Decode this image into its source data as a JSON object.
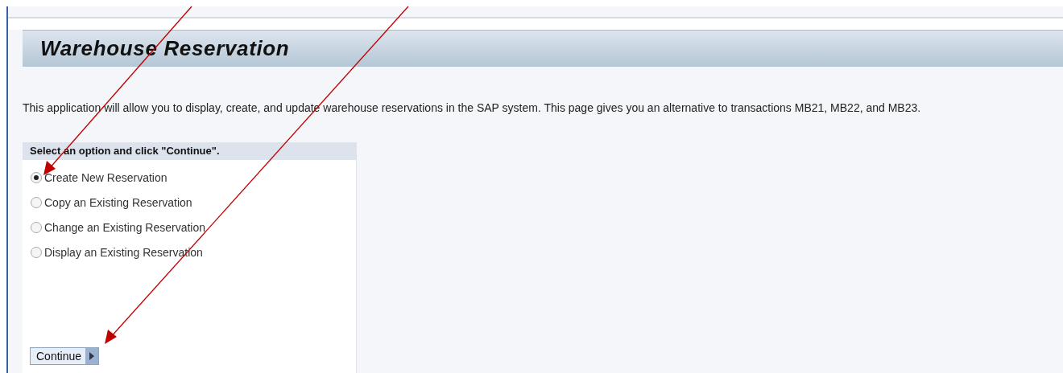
{
  "page": {
    "title": "Warehouse Reservation",
    "intro": "This application will allow you to display, create, and update warehouse reservations in the SAP system.  This page gives you an alternative to transactions MB21, MB22, and MB23."
  },
  "options_panel": {
    "heading": "Select an option and click \"Continue\".",
    "options": [
      {
        "label": "Create New Reservation",
        "selected": true
      },
      {
        "label": "Copy an Existing Reservation",
        "selected": false
      },
      {
        "label": "Change an Existing Reservation",
        "selected": false
      },
      {
        "label": "Display an Existing Reservation",
        "selected": false
      }
    ],
    "button": "Continue"
  }
}
